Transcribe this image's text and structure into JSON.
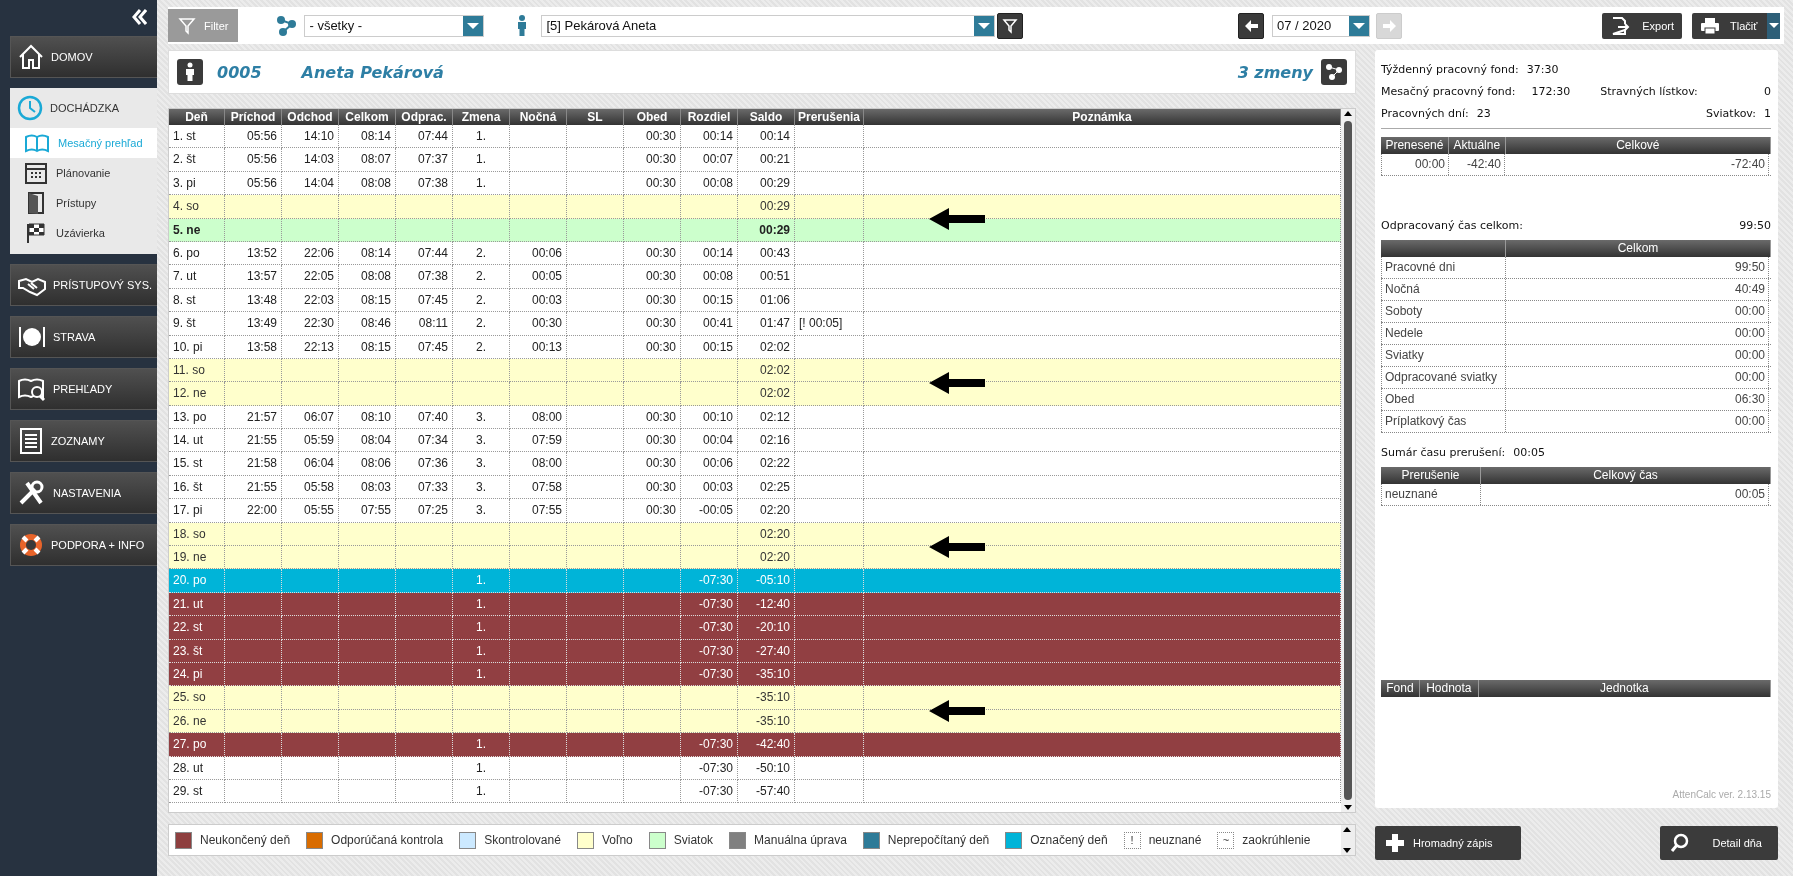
{
  "sidebar": {
    "items": [
      {
        "label": "DOMOV",
        "expanded": false
      },
      {
        "label": "DOCHÁDZKA",
        "expanded": true,
        "children": [
          {
            "label": "Mesačný prehľad",
            "selected": true
          },
          {
            "label": "Plánovanie",
            "selected": false
          },
          {
            "label": "Prístupy",
            "selected": false
          },
          {
            "label": "Uzávierka",
            "selected": false
          }
        ]
      },
      {
        "label": "PRÍSTUPOVÝ SYS.",
        "expanded": false
      },
      {
        "label": "STRAVA",
        "expanded": false
      },
      {
        "label": "PREHĽADY",
        "expanded": false
      },
      {
        "label": "ZOZNAMY",
        "expanded": false
      },
      {
        "label": "NASTAVENIA",
        "expanded": false
      },
      {
        "label": "PODPORA + INFO",
        "expanded": false
      }
    ]
  },
  "toolbar": {
    "filter_button": "Filter",
    "group_select": {
      "value": "- všetky -"
    },
    "employee_select": {
      "value": "[5] Pekárová Aneta"
    },
    "prev_month": {
      "disabled": false
    },
    "month_select": {
      "value": "07 / 2020"
    },
    "next_month": {
      "disabled": true
    },
    "buttons": [
      "Export",
      "Tlačiť"
    ]
  },
  "employee": {
    "number": "0005",
    "name": "Aneta Pekárová",
    "shifts": "3 zmeny"
  },
  "table": {
    "columns": [
      "Deň",
      "Príchod",
      "Odchod",
      "Celkom",
      "Odprac.",
      "Zmena",
      "Nočná",
      "SL",
      "Obed",
      "Rozdiel",
      "Saldo",
      "Prerušenia",
      "Poznámka"
    ],
    "rows": [
      {
        "kind": "normal",
        "arrow": false,
        "cells": [
          "1. st",
          "05:56",
          "14:10",
          "08:14",
          "07:44",
          "1.",
          null,
          null,
          "00:30",
          "00:14",
          "00:14",
          null,
          null
        ]
      },
      {
        "kind": "normal",
        "arrow": false,
        "cells": [
          "2. št",
          "05:56",
          "14:03",
          "08:07",
          "07:37",
          "1.",
          null,
          null,
          "00:30",
          "00:07",
          "00:21",
          null,
          null
        ]
      },
      {
        "kind": "normal",
        "arrow": false,
        "cells": [
          "3. pi",
          "05:56",
          "14:04",
          "08:08",
          "07:38",
          "1.",
          null,
          null,
          "00:30",
          "00:08",
          "00:29",
          null,
          null
        ]
      },
      {
        "kind": "weekend",
        "arrow": true,
        "cells": [
          "4. so",
          null,
          null,
          null,
          null,
          null,
          null,
          null,
          null,
          null,
          "00:29",
          null,
          null
        ]
      },
      {
        "kind": "holiday",
        "arrow": false,
        "cells": [
          "5. ne",
          null,
          null,
          null,
          null,
          null,
          null,
          null,
          null,
          null,
          "00:29",
          null,
          null
        ]
      },
      {
        "kind": "normal",
        "arrow": false,
        "cells": [
          "6. po",
          "13:52",
          "22:06",
          "08:14",
          "07:44",
          "2.",
          "00:06",
          null,
          "00:30",
          "00:14",
          "00:43",
          null,
          null
        ]
      },
      {
        "kind": "normal",
        "arrow": false,
        "cells": [
          "7. ut",
          "13:57",
          "22:05",
          "08:08",
          "07:38",
          "2.",
          "00:05",
          null,
          "00:30",
          "00:08",
          "00:51",
          null,
          null
        ]
      },
      {
        "kind": "normal",
        "arrow": false,
        "cells": [
          "8. st",
          "13:48",
          "22:03",
          "08:15",
          "07:45",
          "2.",
          "00:03",
          null,
          "00:30",
          "00:15",
          "01:06",
          null,
          null
        ]
      },
      {
        "kind": "normal",
        "arrow": false,
        "cells": [
          "9. št",
          "13:49",
          "22:30",
          "08:46",
          "08:11",
          "2.",
          "00:30",
          null,
          "00:30",
          "00:41",
          "01:47",
          "[! 00:05]",
          null
        ]
      },
      {
        "kind": "normal",
        "arrow": false,
        "cells": [
          "10. pi",
          "13:58",
          "22:13",
          "08:15",
          "07:45",
          "2.",
          "00:13",
          null,
          "00:30",
          "00:15",
          "02:02",
          null,
          null
        ]
      },
      {
        "kind": "weekend",
        "arrow": true,
        "cells": [
          "11. so",
          null,
          null,
          null,
          null,
          null,
          null,
          null,
          null,
          null,
          "02:02",
          null,
          null
        ]
      },
      {
        "kind": "weekend",
        "arrow": false,
        "cells": [
          "12. ne",
          null,
          null,
          null,
          null,
          null,
          null,
          null,
          null,
          null,
          "02:02",
          null,
          null
        ]
      },
      {
        "kind": "normal",
        "arrow": false,
        "cells": [
          "13. po",
          "21:57",
          "06:07",
          "08:10",
          "07:40",
          "3.",
          "08:00",
          null,
          "00:30",
          "00:10",
          "02:12",
          null,
          null
        ]
      },
      {
        "kind": "normal",
        "arrow": false,
        "cells": [
          "14. ut",
          "21:55",
          "05:59",
          "08:04",
          "07:34",
          "3.",
          "07:59",
          null,
          "00:30",
          "00:04",
          "02:16",
          null,
          null
        ]
      },
      {
        "kind": "normal",
        "arrow": false,
        "cells": [
          "15. st",
          "21:58",
          "06:04",
          "08:06",
          "07:36",
          "3.",
          "08:00",
          null,
          "00:30",
          "00:06",
          "02:22",
          null,
          null
        ]
      },
      {
        "kind": "normal",
        "arrow": false,
        "cells": [
          "16. št",
          "21:55",
          "05:58",
          "08:03",
          "07:33",
          "3.",
          "07:58",
          null,
          "00:30",
          "00:03",
          "02:25",
          null,
          null
        ]
      },
      {
        "kind": "normal",
        "arrow": false,
        "cells": [
          "17. pi",
          "22:00",
          "05:55",
          "07:55",
          "07:25",
          "3.",
          "07:55",
          null,
          "00:30",
          "-00:05",
          "02:20",
          null,
          null
        ]
      },
      {
        "kind": "weekend",
        "arrow": true,
        "cells": [
          "18. so",
          null,
          null,
          null,
          null,
          null,
          null,
          null,
          null,
          null,
          "02:20",
          null,
          null
        ]
      },
      {
        "kind": "weekend",
        "arrow": false,
        "cells": [
          "19. ne",
          null,
          null,
          null,
          null,
          null,
          null,
          null,
          null,
          null,
          "02:20",
          null,
          null
        ]
      },
      {
        "kind": "marked",
        "arrow": false,
        "cells": [
          "20. po",
          null,
          null,
          null,
          null,
          "1.",
          null,
          null,
          null,
          "-07:30",
          "-05:10",
          null,
          null
        ]
      },
      {
        "kind": "unfinished",
        "arrow": false,
        "cells": [
          "21. ut",
          null,
          null,
          null,
          null,
          "1.",
          null,
          null,
          null,
          "-07:30",
          "-12:40",
          null,
          null
        ]
      },
      {
        "kind": "unfinished",
        "arrow": false,
        "cells": [
          "22. st",
          null,
          null,
          null,
          null,
          "1.",
          null,
          null,
          null,
          "-07:30",
          "-20:10",
          null,
          null
        ]
      },
      {
        "kind": "unfinished",
        "arrow": false,
        "cells": [
          "23. št",
          null,
          null,
          null,
          null,
          "1.",
          null,
          null,
          null,
          "-07:30",
          "-27:40",
          null,
          null
        ]
      },
      {
        "kind": "unfinished",
        "arrow": false,
        "cells": [
          "24. pi",
          null,
          null,
          null,
          null,
          "1.",
          null,
          null,
          null,
          "-07:30",
          "-35:10",
          null,
          null
        ]
      },
      {
        "kind": "weekend",
        "arrow": true,
        "cells": [
          "25. so",
          null,
          null,
          null,
          null,
          null,
          null,
          null,
          null,
          null,
          "-35:10",
          null,
          null
        ]
      },
      {
        "kind": "weekend",
        "arrow": false,
        "cells": [
          "26. ne",
          null,
          null,
          null,
          null,
          null,
          null,
          null,
          null,
          null,
          "-35:10",
          null,
          null
        ]
      },
      {
        "kind": "unfinished",
        "arrow": false,
        "cells": [
          "27. po",
          null,
          null,
          null,
          null,
          "1.",
          null,
          null,
          null,
          "-07:30",
          "-42:40",
          null,
          null
        ]
      },
      {
        "kind": "normal",
        "arrow": false,
        "cells": [
          "28. ut",
          null,
          null,
          null,
          null,
          "1.",
          null,
          null,
          null,
          "-07:30",
          "-50:10",
          null,
          null
        ]
      },
      {
        "kind": "normal",
        "arrow": false,
        "cells": [
          "29. st",
          null,
          null,
          null,
          null,
          "1.",
          null,
          null,
          null,
          "-07:30",
          "-57:40",
          null,
          null
        ]
      }
    ]
  },
  "legend": {
    "items": [
      {
        "kind": "swatch",
        "color": "#8e3f3f",
        "label": "Neukončený deň"
      },
      {
        "kind": "swatch",
        "color": "#d96c00",
        "label": "Odporúčaná kontrola"
      },
      {
        "kind": "swatch",
        "color": "#cce9ff",
        "label": "Skontrolované"
      },
      {
        "kind": "swatch",
        "color": "#ffffcc",
        "label": "Voľno"
      },
      {
        "kind": "swatch",
        "color": "#ccffcc",
        "label": "Sviatok"
      },
      {
        "kind": "swatch",
        "color": "#808080",
        "label": "Manuálna úprava"
      },
      {
        "kind": "swatch",
        "color": "#2e7b98",
        "label": "Neprepočítaný deň"
      },
      {
        "kind": "swatch",
        "color": "#00b4d8",
        "label": "Označený deň"
      },
      {
        "kind": "symbol",
        "symbol": "!",
        "label": "neuznané"
      },
      {
        "kind": "symbol",
        "symbol": "~",
        "label": "zaokrúhlenie"
      }
    ]
  },
  "summary": {
    "stats": [
      {
        "label": "Týždenný pracovný fond:",
        "value": "37:30"
      },
      {
        "label": "Mesačný pracovný fond:",
        "value": "172:30"
      },
      {
        "label": "Stravných lístkov:",
        "value": "0"
      },
      {
        "label": "Pracovných dní:",
        "value": "23"
      },
      {
        "label": "Sviatkov:",
        "value": "1"
      }
    ],
    "balance": {
      "columns": [
        "Prenesené",
        "Aktuálne",
        "Celkové"
      ],
      "row": [
        "00:00",
        "-42:40",
        "-72:40"
      ]
    },
    "worked_total": {
      "label": "Odpracovaný čas celkom:",
      "value": "99:50"
    },
    "worked": {
      "columns": [
        "Celkom"
      ],
      "rows": [
        {
          "label": "Pracovné dni",
          "value": "99:50"
        },
        {
          "label": "Nočná",
          "value": "40:49"
        },
        {
          "label": "Soboty",
          "value": "00:00"
        },
        {
          "label": "Nedele",
          "value": "00:00"
        },
        {
          "label": "Sviatky",
          "value": "00:00"
        },
        {
          "label": "Odpracované sviatky",
          "value": "00:00"
        },
        {
          "label": "Obed",
          "value": "06:30"
        },
        {
          "label": "Príplatkový čas",
          "value": "00:00"
        }
      ]
    },
    "interruptions_total": {
      "label": "Sumár času prerušení:",
      "value": "00:05"
    },
    "interruptions": {
      "columns": [
        "Prerušenie",
        "Celkový čas"
      ],
      "rows": [
        {
          "label": "neuznané",
          "value": "00:05"
        }
      ]
    },
    "fund": {
      "columns": [
        "Fond",
        "Hodnota",
        "Jednotka"
      ]
    },
    "version": "AttenCalc ver. 2.13.15"
  },
  "bottom_buttons": [
    "Hromadný zápis",
    "Detail dňa"
  ]
}
